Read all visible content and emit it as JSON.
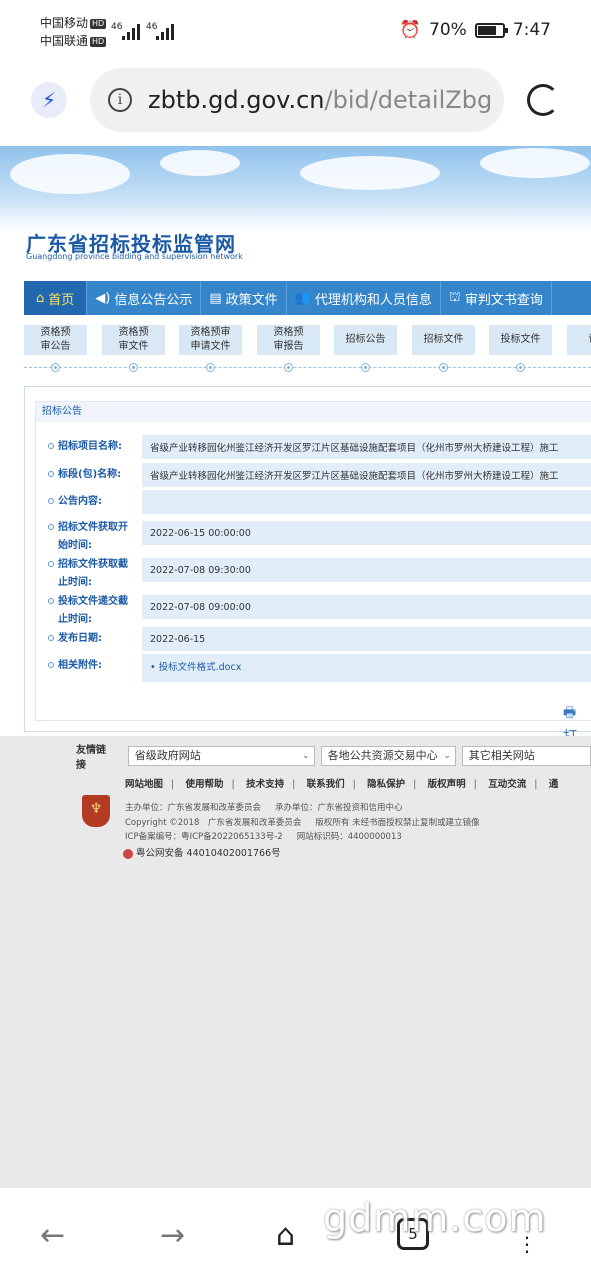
{
  "status": {
    "carrier1": "中国移动",
    "carrier2": "中国联通",
    "hd": "HD",
    "net": "46",
    "battery": "70%",
    "time": "7:47"
  },
  "browser": {
    "url_host": "zbtb.gd.gov.cn",
    "url_path": "/bid/detailZbg",
    "info_glyph": "i",
    "tab_count": "5"
  },
  "site": {
    "title": "广东省招标投标监管网",
    "subtitle": "Guangdong province bidding and supervision network"
  },
  "nav": [
    {
      "label": "首页",
      "icon": "home-icon",
      "glyph": "⌂"
    },
    {
      "label": "信息公告公示",
      "icon": "speaker-icon",
      "glyph": "◀)"
    },
    {
      "label": "政策文件",
      "icon": "document-icon",
      "glyph": "▤"
    },
    {
      "label": "代理机构和人员信息",
      "icon": "people-icon",
      "glyph": "👥"
    },
    {
      "label": "审判文书查询",
      "icon": "court-icon",
      "glyph": "⛫"
    }
  ],
  "steps": [
    "资格预审公告",
    "资格预审文件",
    "资格预审申请文件",
    "资格预审报告",
    "招标公告",
    "招标文件",
    "投标文件",
    "评标"
  ],
  "panel": {
    "title": "招标公告",
    "fields": [
      {
        "label": "招标项目名称:",
        "value": "省级产业转移园化州鉴江经济开发区罗江片区基础设施配套项目（化州市罗州大桥建设工程）施工"
      },
      {
        "label": "标段(包)名称:",
        "value": "省级产业转移园化州鉴江经济开发区罗江片区基础设施配套项目（化州市罗州大桥建设工程）施工"
      },
      {
        "label": "公告内容:",
        "value": ""
      },
      {
        "label": "招标文件获取开始时间:",
        "value": "2022-06-15 00:00:00"
      },
      {
        "label": "招标文件获取截止时间:",
        "value": "2022-07-08 09:30:00"
      },
      {
        "label": "投标文件递交截止时间:",
        "value": "2022-07-08 09:00:00"
      },
      {
        "label": "发布日期:",
        "value": "2022-06-15"
      },
      {
        "label": "相关附件:",
        "value": "• 投标文件格式.docx"
      }
    ],
    "print_label": "打"
  },
  "footer": {
    "links_label": "友情链接",
    "selects": [
      "省级政府网站",
      "各地公共资源交易中心",
      "其它相关网站"
    ],
    "footlinks": [
      "网站地图",
      "使用帮助",
      "技术支持",
      "联系我们",
      "隐私保护",
      "版权声明",
      "互动交流",
      "通"
    ],
    "info_lines": [
      [
        "主办单位：广东省发展和改革委员会",
        "承办单位：广东省投资和信用中心"
      ],
      [
        "Copyright ©2018　广东省发展和改革委员会",
        "版权所有 未经书面授权禁止复制或建立镜像"
      ],
      [
        "ICP备案编号：粤ICP备2022065133号-2",
        "网站标识码：4400000013"
      ]
    ],
    "police": "粤公网安备 44010402001766号"
  },
  "bottom": {
    "watermark": "gdmm.com"
  }
}
